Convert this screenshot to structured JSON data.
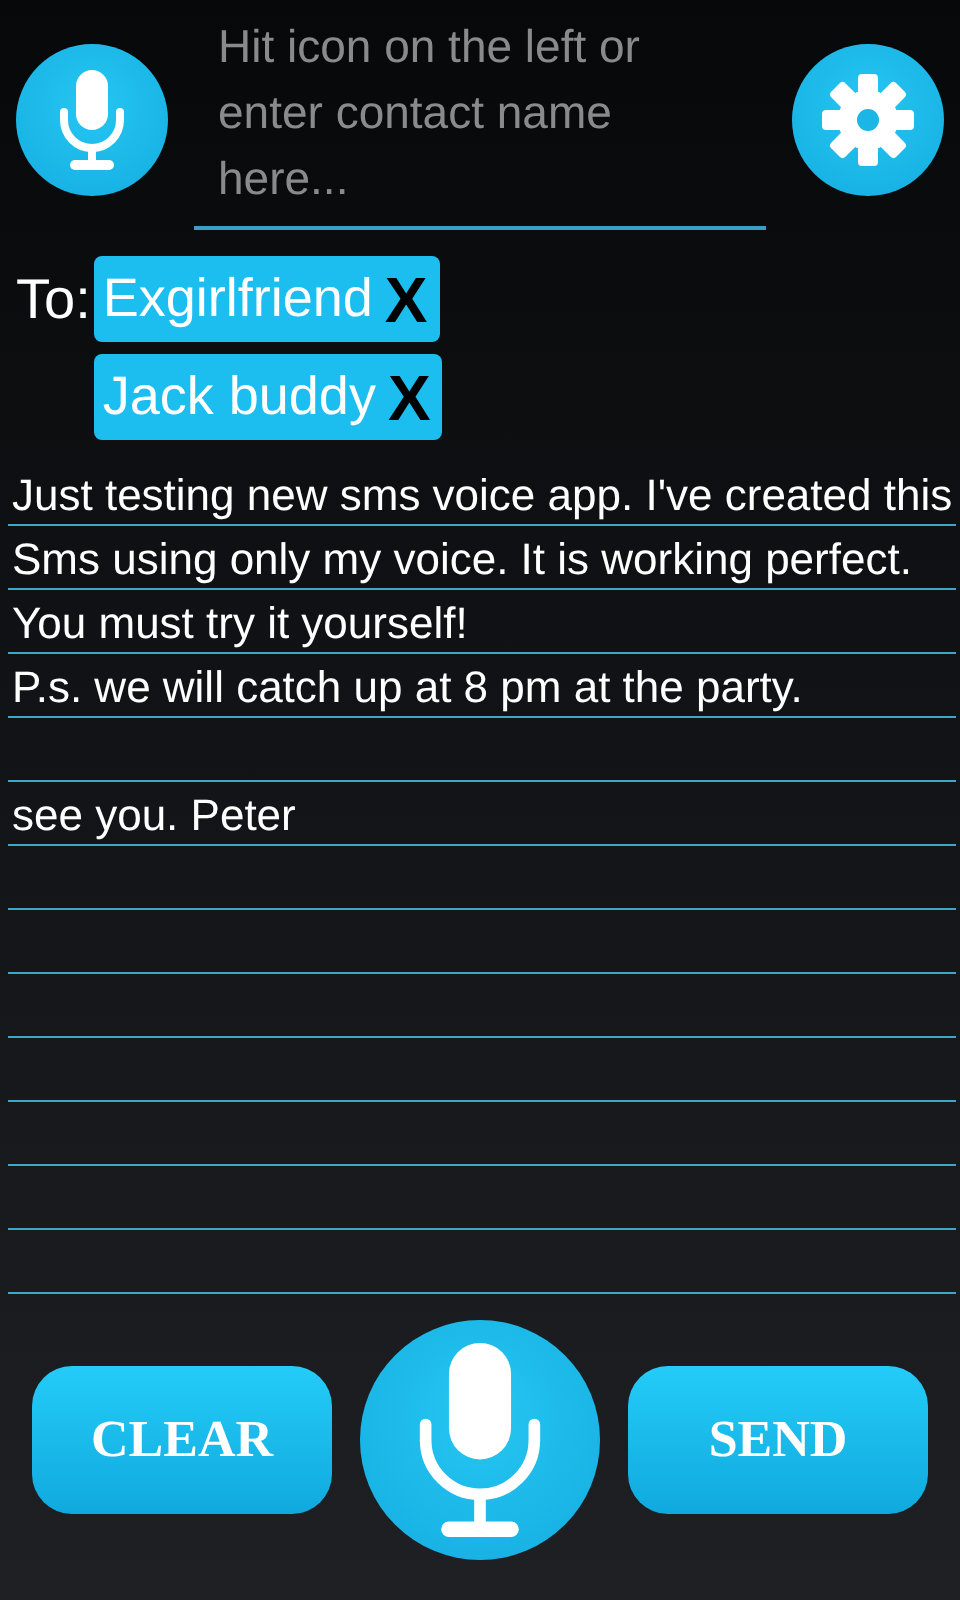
{
  "contact_field": {
    "placeholder": "Hit icon on the left or enter contact name here..."
  },
  "to_label": "To:",
  "recipients": [
    {
      "name": "Exgirlfriend",
      "remove": "X"
    },
    {
      "name": "Jack buddy",
      "remove": "X"
    }
  ],
  "message": "Just testing new sms voice app. I've created this Sms using only my voice. It is working perfect. You must try it yourself!\nP.s. we will catch up at 8 pm at the party.\n\nsee you. Peter",
  "buttons": [
    {
      "kind": "clear",
      "label": "CLEAR"
    },
    {
      "kind": "send",
      "label": "SEND"
    }
  ]
}
